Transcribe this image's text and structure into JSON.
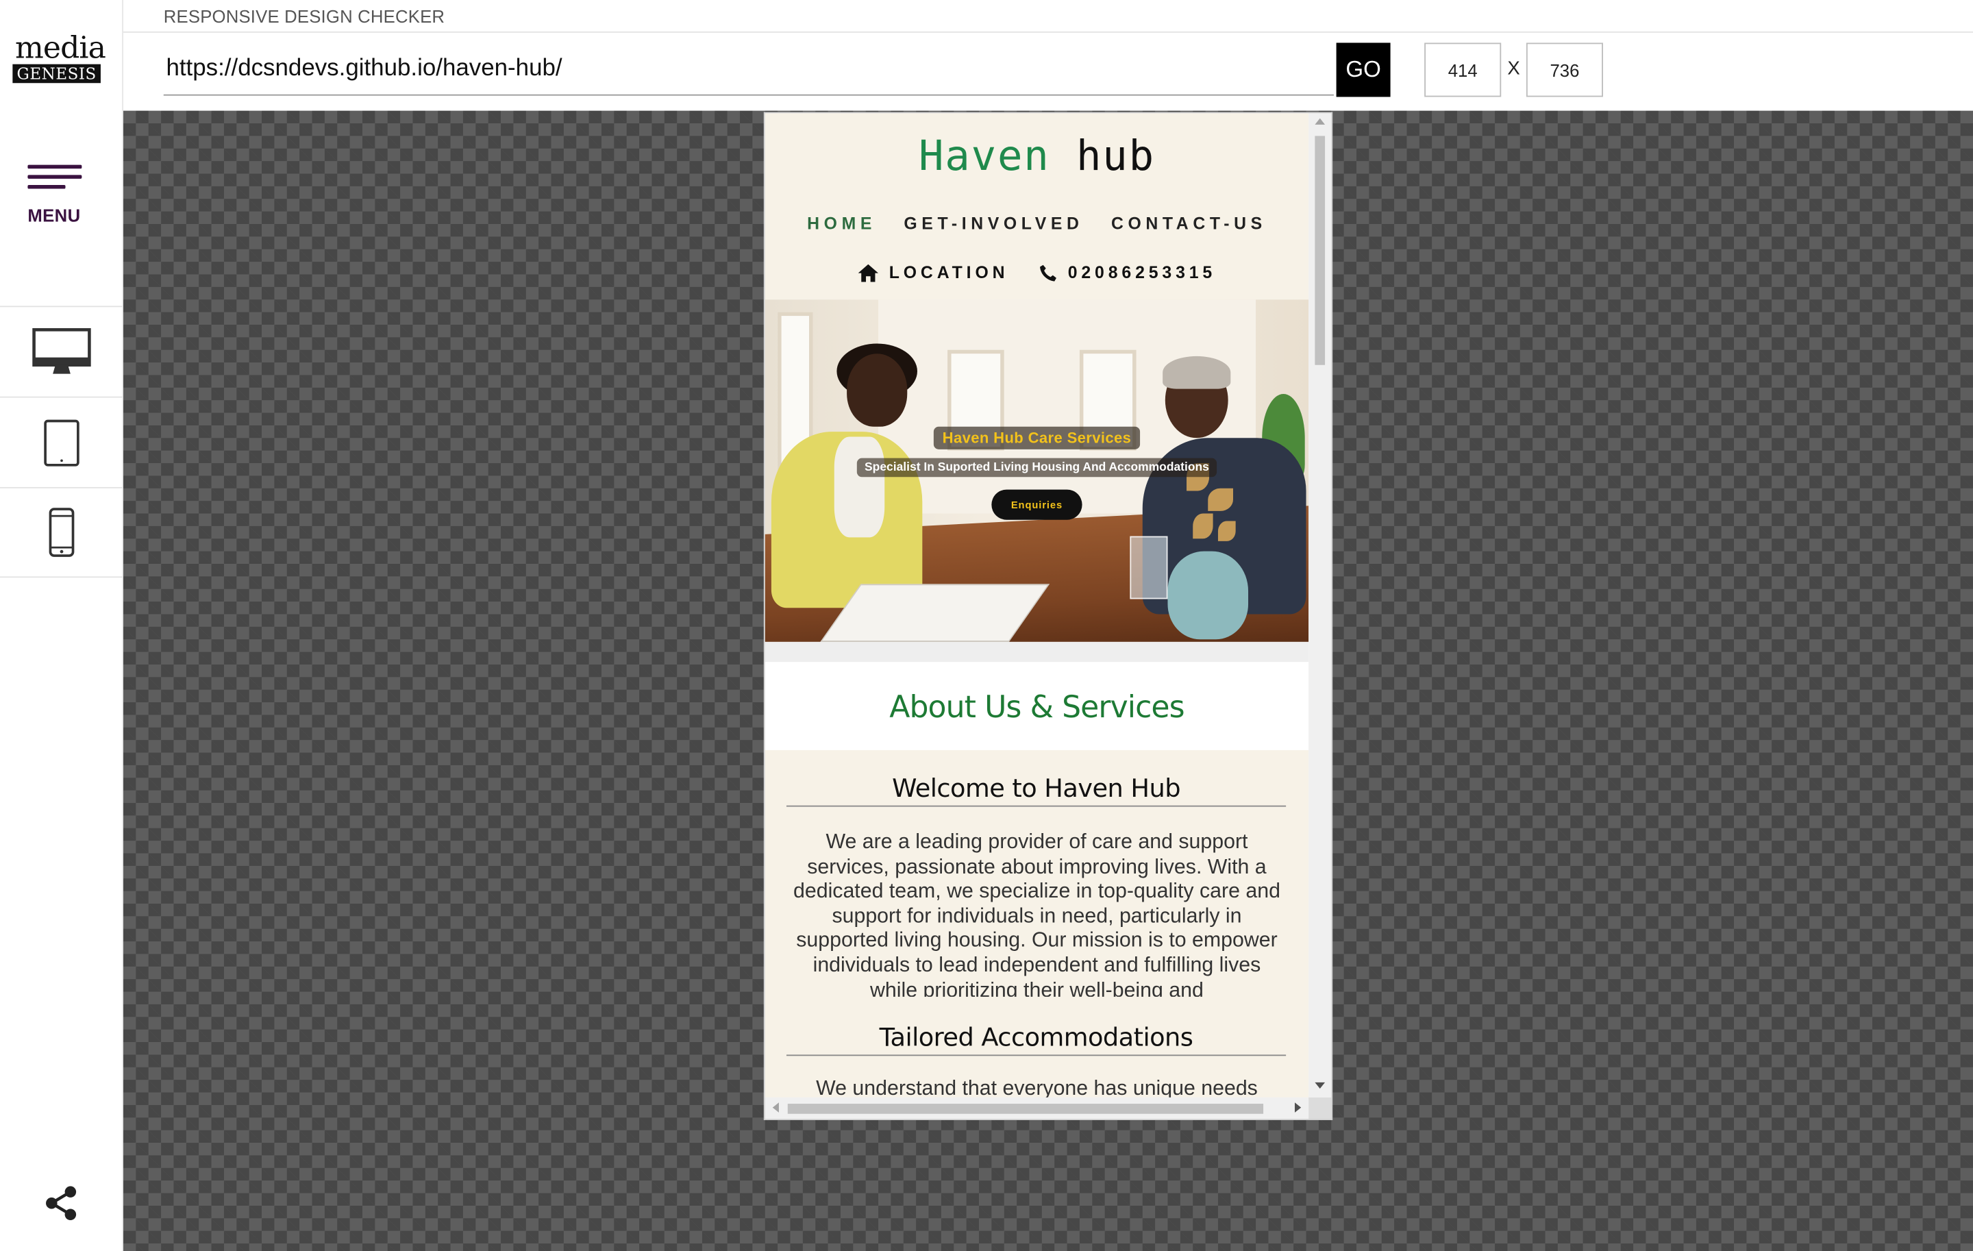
{
  "app": {
    "title": "RESPONSIVE DESIGN CHECKER",
    "logo_top": "media",
    "logo_bottom": "GENESIS",
    "menu_label": "MENU"
  },
  "toolbar": {
    "url": "https://dcsndevs.github.io/haven-hub/",
    "go_label": "GO",
    "width_value": "414",
    "height_value": "736",
    "separator": "X"
  },
  "sidebar": {
    "devices": [
      {
        "name": "desktop",
        "icon": "desktop-monitor-icon"
      },
      {
        "name": "tablet",
        "icon": "tablet-icon"
      },
      {
        "name": "phone",
        "icon": "smartphone-icon"
      }
    ],
    "share_icon": "share-icon"
  },
  "site": {
    "brand_part1": "Haven",
    "brand_part2": "hub",
    "nav": [
      "HOME",
      "GET-INVOLVED",
      "CONTACT-US"
    ],
    "contact_location": "LOCATION",
    "contact_phone": "02086253315",
    "hero_title": "Haven Hub Care Services",
    "hero_subtitle": "Specialist In Suported Living Housing And Accommodations",
    "hero_button": "Enquiries",
    "about_title": "About Us & Services",
    "welcome_title": "Welcome to Haven Hub",
    "welcome_text": "We are a leading provider of care and support services, passionate about improving lives. With a dedicated team, we specialize in top-quality care and support for individuals in need, particularly in supported living housing. Our mission is to empower individuals to lead independent and fulfilling lives while prioritizing their well-being and",
    "tailored_title": "Tailored Accommodations",
    "tailored_text": "We understand that everyone has unique needs"
  },
  "colors": {
    "brand_green": "#1f8a4c",
    "accent_yellow": "#f3c21b",
    "menu_purple": "#3a1240",
    "site_background": "#f7f2e7"
  }
}
